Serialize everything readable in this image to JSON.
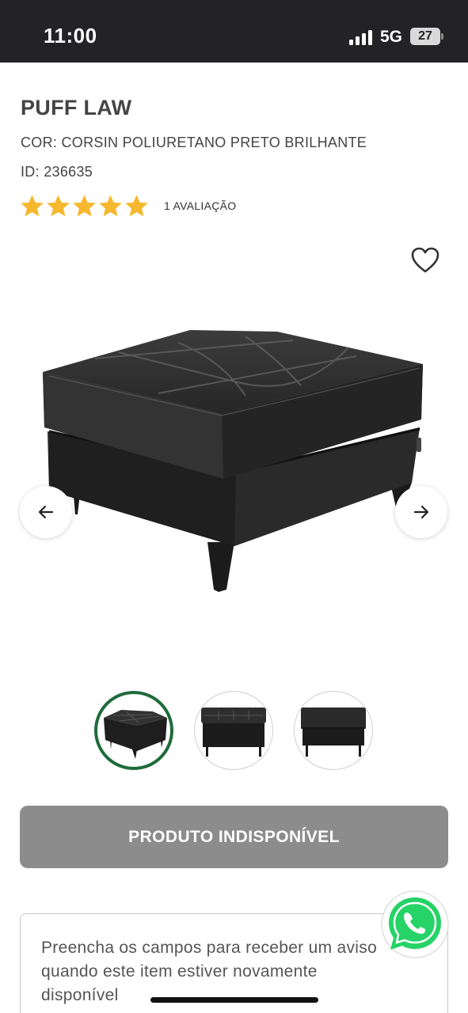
{
  "status_bar": {
    "time": "11:00",
    "network": "5G",
    "battery": "27",
    "icons": [
      "signal-icon",
      "battery-icon"
    ]
  },
  "product": {
    "title": "PUFF LAW",
    "color": "COR: CORSIN POLIURETANO PRETO BRILHANTE",
    "id": "ID: 236635",
    "rating_stars": 5,
    "rating_label": "1 AVALIAÇÃO"
  },
  "gallery": {
    "thumbnail_count": 3,
    "active_thumbnail": 1,
    "icons": [
      "heart-icon",
      "arrow-left-icon",
      "arrow-right-icon"
    ]
  },
  "actions": {
    "unavailable_label": "PRODUTO INDISPONÍVEL"
  },
  "notify": {
    "text": "Preencha os campos para receber um aviso quando este item estiver novamente disponível"
  },
  "colors": {
    "status_bar_bg": "#232326",
    "star": "#f5b82e",
    "active_thumb_border": "#1f6b3b",
    "disabled_button": "#8c8c8c",
    "whatsapp": "#25d366"
  }
}
